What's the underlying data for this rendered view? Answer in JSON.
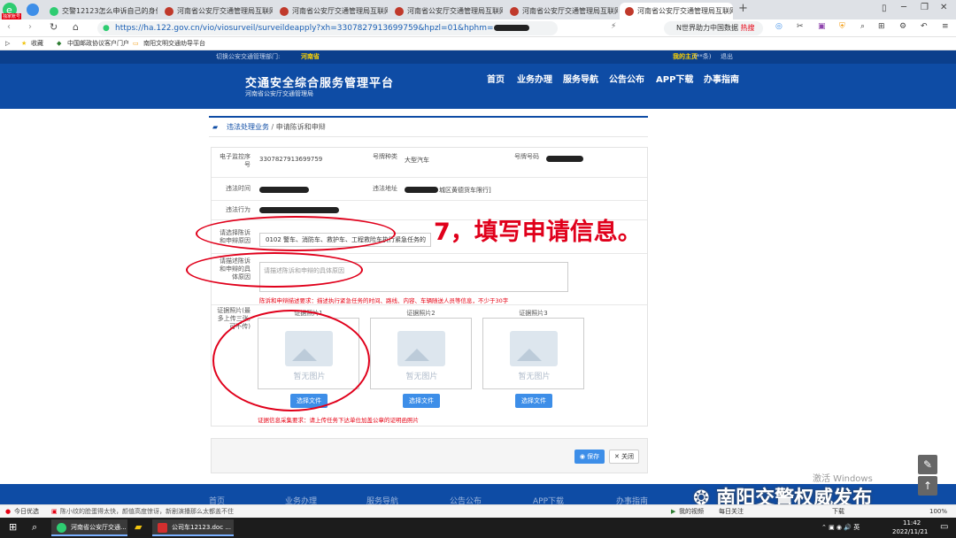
{
  "browser": {
    "tabs": [
      {
        "label": "交警12123怎么申诉自己的身份"
      },
      {
        "label": "河南省公安厅交通管理局互联网"
      },
      {
        "label": "河南省公安厅交通管理局互联网"
      },
      {
        "label": "河南省公安厅交通管理局互联网"
      },
      {
        "label": "河南省公安厅交通管理局互联网"
      },
      {
        "label": "河南省公安厅交通管理局互联网"
      }
    ],
    "badge": "独家账号",
    "url": "https://ha.122.gov.cn/vio/viosurveil/surveildeapply?xh=3307827913699759&hpzl=01&hphm=",
    "search": "N世界助力中国数据",
    "search_badge": "热搜",
    "bookmarks": [
      "收藏",
      "中国邮政协议客户门户",
      "南阳文明交通劝导平台"
    ]
  },
  "site": {
    "top_left": "切换公安交通管理部门:",
    "top_region": "河南省",
    "top_right_home": "我的主页",
    "top_right_count": "(**条)",
    "top_right_logout": "退出",
    "title": "交通安全综合服务管理平台",
    "subtitle": "河南省公安厅交通管理局",
    "nav": [
      "首页",
      "业务办理",
      "服务导航",
      "公告公布",
      "APP下载",
      "办事指南"
    ]
  },
  "breadcrumb": {
    "section": "违法处理业务",
    "current": "申请陈诉和申辩"
  },
  "form": {
    "surveil_no_label": "电子监控序号",
    "surveil_no": "3307827913699759",
    "plate_type_label": "号牌种类",
    "plate_type": "大型汽车",
    "plate_no_label": "号牌号码",
    "vio_time_label": "违法时间",
    "vio_place_label": "违法地址",
    "vio_place_suffix": "城区黄德货车限行]",
    "vio_act_label": "违法行为",
    "reason_select_label": "请选择陈诉和申辩原因",
    "reason_selected": "0102 警车、消防车、救护车、工程救险车执行紧急任务的",
    "detail_label": "请描述陈诉和申辩的具体原因",
    "detail_placeholder": "请描述陈诉和申辩的具体原因",
    "detail_hint": "陈诉和申辩描述要求：描述执行紧急任务的时间、路线、内容、车辆随送人员等信息，不少于30字",
    "photo_label": "证据照片(最多上传三张,可不传)",
    "photos": [
      {
        "caption": "证据照片1",
        "empty": "暂无图片",
        "button": "选择文件"
      },
      {
        "caption": "证据照片2",
        "empty": "暂无图片",
        "button": "选择文件"
      },
      {
        "caption": "证据照片3",
        "empty": "暂无图片",
        "button": "选择文件"
      }
    ],
    "photo_hint": "证据信息采集要求：请上传任务下达单位加盖公章的证明函照片"
  },
  "actions": {
    "save": "保存",
    "close": "关闭"
  },
  "footer_nav": [
    "首页",
    "业务办理",
    "服务导航",
    "公告公布",
    "APP下载",
    "办事指南"
  ],
  "annotation": "7，填写申请信息。",
  "watermark": "南阳交警权威发布",
  "activate_windows": "激活 Windows",
  "statusbar": {
    "left": "今日优选",
    "news": "陈小纹的脸蛋得太快，颜值高度惊讶，新剧演播那么太都盖不住",
    "video": "我的视频",
    "follow": "每日关注",
    "download": "下载",
    "zoom": "100%"
  },
  "taskbar": {
    "tasks": [
      "河南省公安厅交通...",
      "公司车12123.doc ..."
    ],
    "time": "11:42",
    "date": "2022/11/21"
  }
}
